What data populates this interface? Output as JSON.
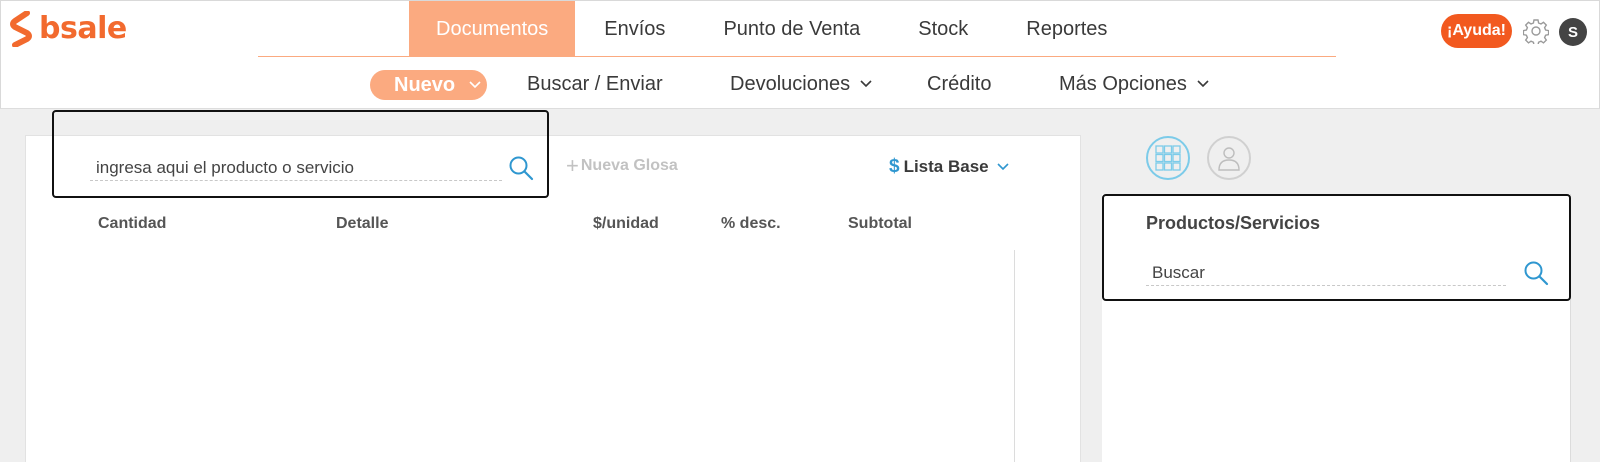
{
  "app": {
    "logo_text": "bsale",
    "brand_color": "#f26a2e",
    "accent_color": "#fbaa80"
  },
  "main_nav": {
    "items": [
      {
        "label": "Documentos",
        "active": true
      },
      {
        "label": "Envíos"
      },
      {
        "label": "Punto de Venta"
      },
      {
        "label": "Stock"
      },
      {
        "label": "Reportes"
      }
    ]
  },
  "header_right": {
    "help_label": "¡Ayuda!",
    "settings_icon": "gear-icon",
    "user_initial": "S"
  },
  "sub_nav": {
    "items": [
      {
        "label": "Nuevo",
        "active": true,
        "has_dropdown": true
      },
      {
        "label": "Buscar / Enviar"
      },
      {
        "label": "Devoluciones",
        "has_dropdown": true
      },
      {
        "label": "Crédito"
      },
      {
        "label": "Más Opciones",
        "has_dropdown": true
      }
    ]
  },
  "document": {
    "product_search_placeholder": "ingresa aqui el producto o servicio",
    "new_gloss_label": "Nueva Glosa",
    "price_list_currency": "$",
    "price_list_label": "Lista Base",
    "columns": [
      "Cantidad",
      "Detalle",
      "$/unidad",
      "% desc.",
      "Subtotal"
    ]
  },
  "side_panel": {
    "modes": [
      "grid-icon",
      "user-icon"
    ],
    "title": "Productos/Servicios",
    "search_placeholder": "Buscar"
  }
}
